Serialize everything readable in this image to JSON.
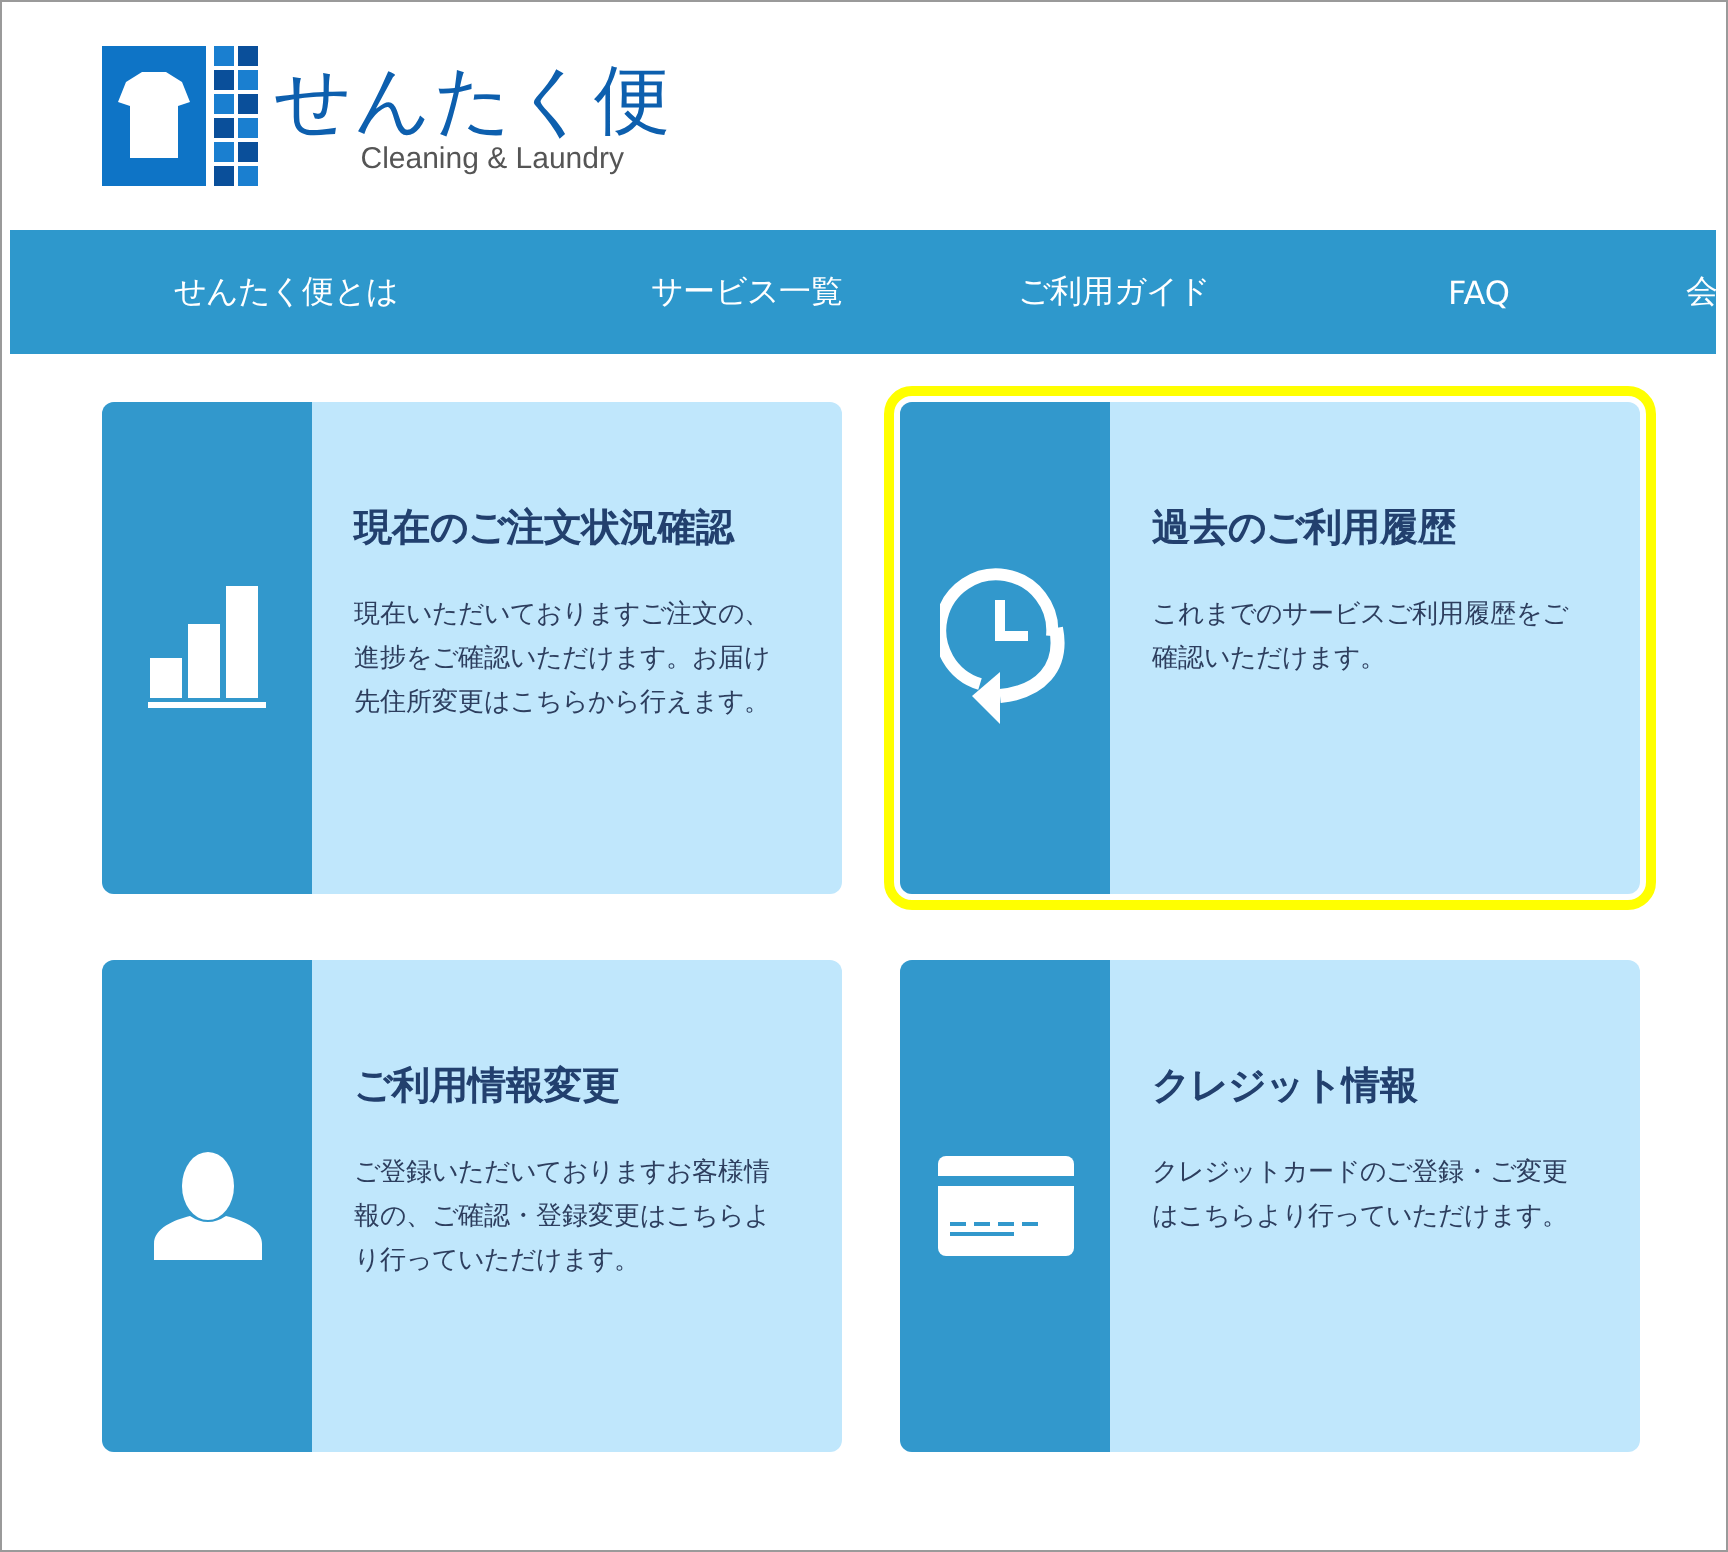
{
  "logo": {
    "title": "せんたく便",
    "subtitle": "Cleaning & Laundry"
  },
  "nav": [
    {
      "label": "せんたく便とは"
    },
    {
      "label": "サービス一覧"
    },
    {
      "label": "ご利用ガイド"
    },
    {
      "label": "FAQ"
    },
    {
      "label": "会"
    }
  ],
  "cards": [
    {
      "kind": "chart",
      "title": "現在のご注文状況確認",
      "description": "現在いただいておりますご注文の、進捗をご確認いただけます。お届け先住所変更はこちらから行えます。",
      "highlighted": false
    },
    {
      "kind": "history",
      "title": "過去のご利用履歴",
      "description": "これまでのサービスご利用履歴をご確認いただけます。",
      "highlighted": true
    },
    {
      "kind": "person",
      "title": "ご利用情報変更",
      "description": "ご登録いただいておりますお客様情報の、ご確認・登録変更はこちらより行っていただけます。",
      "highlighted": false
    },
    {
      "kind": "card",
      "title": "クレジット情報",
      "description": "クレジットカードのご登録・ご変更はこちらより行っていただけます。",
      "highlighted": false
    }
  ]
}
